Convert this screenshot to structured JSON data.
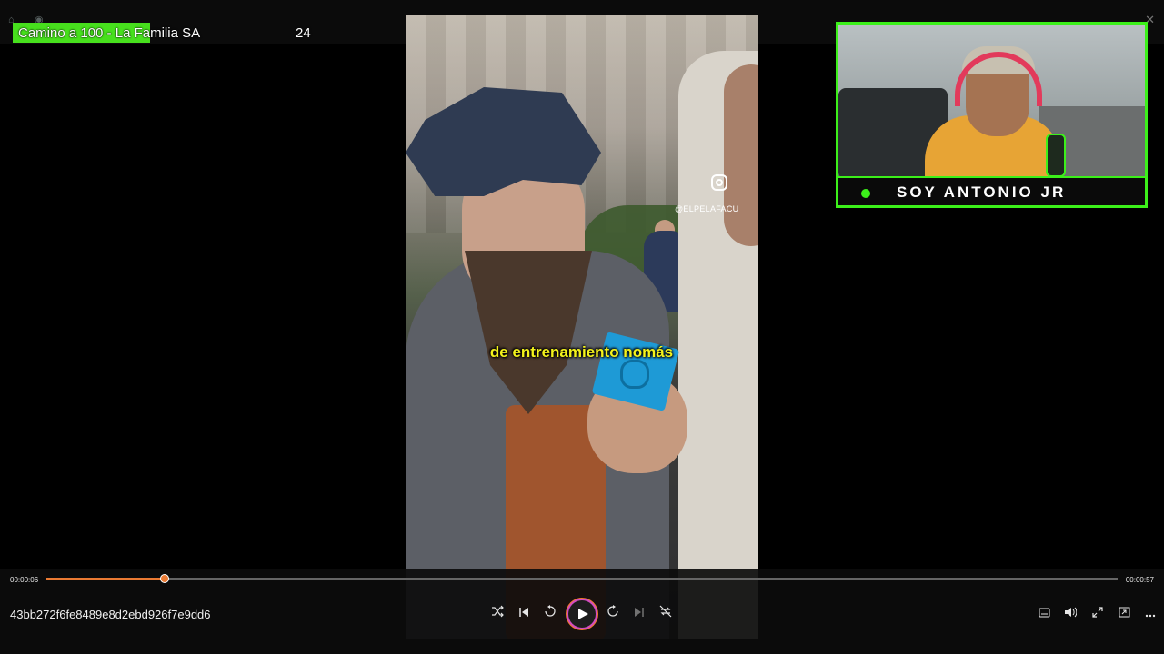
{
  "goal": {
    "title": "Camino a 100 - La Familia SA",
    "current": "24",
    "target": "100",
    "progress_fraction": 0.24,
    "color": "#47e01d"
  },
  "video": {
    "subtitle": "de entrenamiento nomás",
    "instagram_handle": "@ELPELAFACU"
  },
  "webcam": {
    "name": "SOY ANTONIO JR",
    "accent": "#3cf01a"
  },
  "player": {
    "time_current": "00:00:06",
    "time_total": "00:00:57",
    "progress_fraction": 0.11,
    "file_title": "43bb272f6fe8489e8d2ebd926f7e9dd6",
    "accent": "#ea7a33",
    "center_controls": [
      "shuffle-icon",
      "previous-icon",
      "rewind-10-icon",
      "play-icon",
      "forward-30-icon",
      "next-icon",
      "repeat-off-icon"
    ],
    "right_controls": [
      "subtitles-icon",
      "volume-icon",
      "fullscreen-icon",
      "mini-player-icon",
      "more-icon"
    ]
  }
}
